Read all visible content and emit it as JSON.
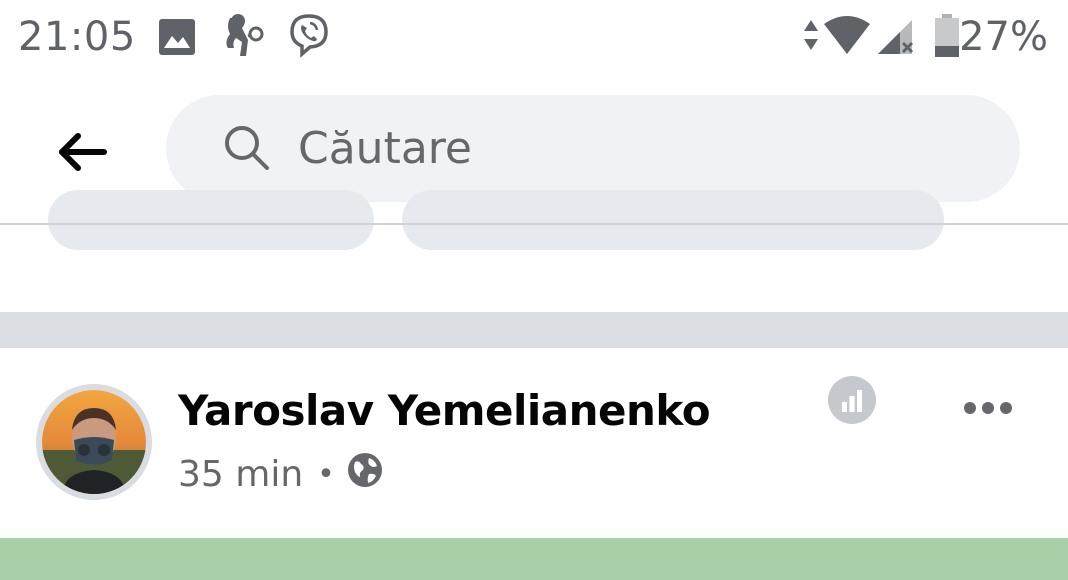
{
  "status_bar": {
    "time": "21:05",
    "battery_percent": "27%",
    "battery_level": 0.27,
    "icons": [
      "image-icon",
      "notification-figure-icon",
      "viber-icon",
      "data-arrows-icon",
      "wifi-icon",
      "cell-signal-icon",
      "battery-icon"
    ]
  },
  "header": {
    "back_icon": "back-arrow-icon",
    "search": {
      "placeholder": "Căutare",
      "icon": "search-icon"
    }
  },
  "post": {
    "author_name": "Yaroslav Yemelianenko",
    "time": "35 min",
    "separator": "•",
    "audience_icon": "globe-icon",
    "stats_icon": "bar-chart-icon",
    "more_icon": "more-dots-icon"
  },
  "colors": {
    "search_bg": "#f0f2f5",
    "section_gap": "#dadde1",
    "post_image": "#a8d0a6",
    "text_primary": "#050505",
    "text_secondary": "#65676b"
  }
}
